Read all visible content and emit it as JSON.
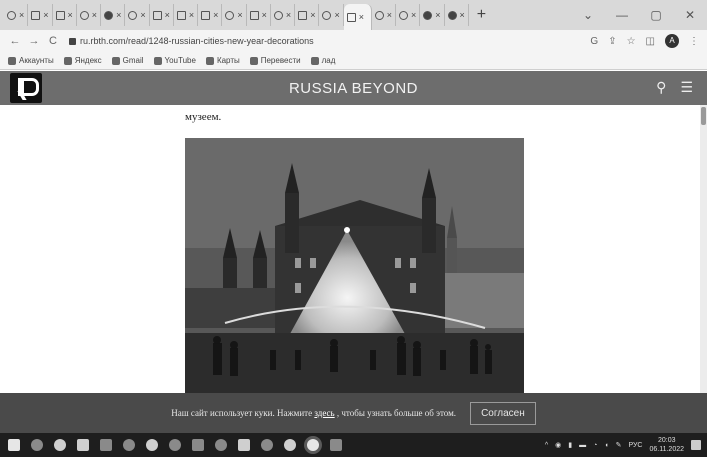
{
  "browser": {
    "tabs": [
      "",
      "",
      "",
      "",
      "",
      "",
      "",
      "",
      "",
      "",
      "",
      "",
      "",
      "",
      "",
      "",
      "",
      "",
      ""
    ],
    "active_tab_close": "×",
    "new_tab": "+",
    "window_controls": [
      "⌄",
      "—",
      "▢",
      "✕"
    ],
    "nav": [
      "←",
      "→",
      "C"
    ],
    "url": "ru.rbth.com/read/1248-russian-cities-new-year-decorations",
    "addr_icons": [
      "G",
      "⇪",
      "☆",
      "◫"
    ],
    "profile_initial": "A"
  },
  "bookmarks": [
    {
      "label": "Аккаунты"
    },
    {
      "label": "Яндекс"
    },
    {
      "label": "Gmail"
    },
    {
      "label": "YouTube"
    },
    {
      "label": "Карты"
    },
    {
      "label": "Перевести"
    },
    {
      "label": "лад"
    }
  ],
  "site": {
    "title": "RUSSIA BEYOND",
    "search_icon": "⚲",
    "menu_icon": "☰"
  },
  "article": {
    "text_fragment": "музеем."
  },
  "cookie": {
    "text_before": "Наш сайт использует куки. Нажмите",
    "link": "здесь",
    "text_after": ", чтобы узнать больше об этом.",
    "button": "Согласен"
  },
  "taskbar": {
    "tray_lang": "РУС",
    "time": "20:03",
    "date": "06.11.2022"
  }
}
